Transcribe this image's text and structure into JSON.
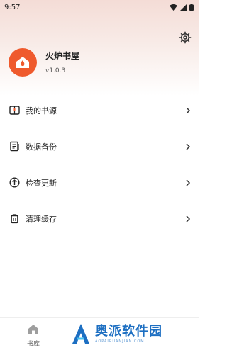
{
  "status_bar": {
    "time": "9:57"
  },
  "profile": {
    "app_name": "火炉书屋",
    "version": "v1.0.3"
  },
  "menu": {
    "items": [
      {
        "label": "我的书源",
        "icon": "book-source-icon"
      },
      {
        "label": "数据备份",
        "icon": "backup-icon"
      },
      {
        "label": "检查更新",
        "icon": "update-icon"
      },
      {
        "label": "清理缓存",
        "icon": "trash-icon"
      }
    ]
  },
  "bottom_nav": {
    "home_label": "书库"
  },
  "watermark": {
    "text": "奥派软件园",
    "sub": "AOPAIRUANJIAN.COM"
  },
  "colors": {
    "accent": "#ef5a2d",
    "watermark_blue": "#1d6fc2"
  }
}
